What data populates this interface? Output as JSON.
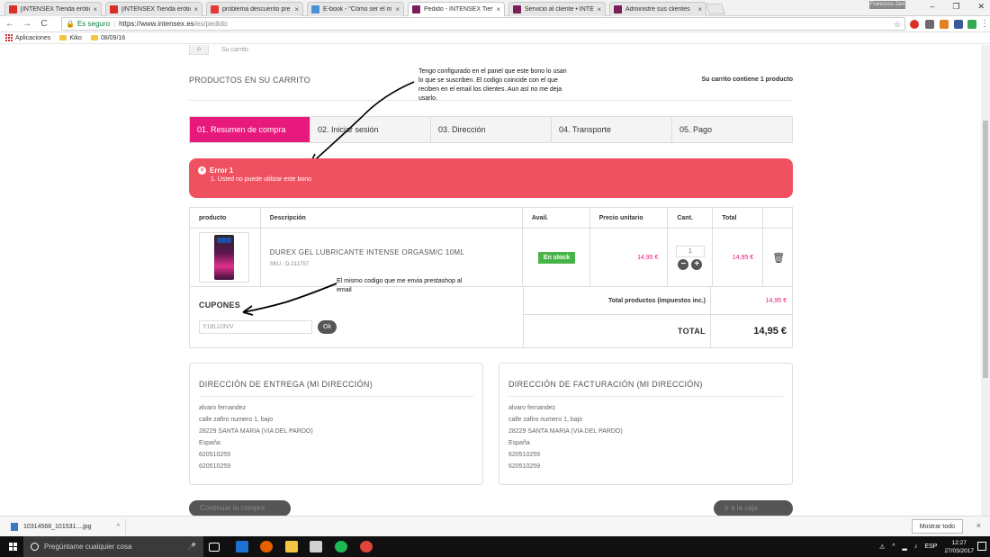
{
  "browser": {
    "tabs": [
      {
        "title": "[INTENSEX Tienda erótica",
        "color": "#d93025",
        "active": false
      },
      {
        "title": "[INTENSEX Tienda erótica",
        "color": "#d93025",
        "active": false
      },
      {
        "title": "problema descuento pre",
        "color": "#e53935",
        "active": false
      },
      {
        "title": "E-book - \"Cómo ser el m",
        "color": "#4a90d9",
        "active": false
      },
      {
        "title": "Pedido - INTENSEX Tien",
        "color": "#7a1f5a",
        "active": true
      },
      {
        "title": "Servicio al cliente • INTE",
        "color": "#7a1f5a",
        "active": false
      },
      {
        "title": "Administre sus clientes",
        "color": "#7a1f5a",
        "active": false
      }
    ],
    "tab_close": "×",
    "user_name": "Francisco Javi",
    "win_min": "–",
    "win_max": "❐",
    "win_close": "✕",
    "back": "←",
    "forward": "→",
    "reload": "C",
    "home": "⌂",
    "secure_label": "Es seguro",
    "url_domain": "https://www.intensex.es",
    "url_path": "/es/pedido",
    "star": "☆",
    "menu": "⋮",
    "bookmarks": [
      {
        "label": "Aplicaciones",
        "type": "apps"
      },
      {
        "label": "Kiko",
        "type": "folder"
      },
      {
        "label": "08/09/16",
        "type": "folder"
      }
    ]
  },
  "page": {
    "breadcrumb_home": "⌂",
    "breadcrumb_current": "Su carrito",
    "title": "PRODUCTOS EN SU CARRITO",
    "cart_count": "Su carrito contiene 1 producto",
    "annotation_top": [
      "Tengo configurado en el panel que este bono lo usan",
      "lo que se suscriben. El codigo coincide con el que",
      "reciben en el email los clientes. Aun así no me deja",
      "usarlo."
    ],
    "annotation_coupon": [
      "El mismo codigo que me envia prestashop al",
      "email"
    ],
    "steps": [
      {
        "label": "01. Resumen de compra",
        "active": true
      },
      {
        "label": "02. Iniciar sesión",
        "active": false
      },
      {
        "label": "03. Dirección",
        "active": false
      },
      {
        "label": "04. Transporte",
        "active": false
      },
      {
        "label": "05. Pago",
        "active": false
      }
    ],
    "error": {
      "icon": "×",
      "title": "Error 1",
      "message": "1. Usted no puede utilizar este bono"
    },
    "table_headers": [
      "producto",
      "Descripción",
      "Avail.",
      "Precio unitario",
      "Cant.",
      "Total",
      ""
    ],
    "product": {
      "name": "DUREX GEL LUBRICANTE INTENSE ORGASMIC 10ML",
      "sku": "SKU : D-211757",
      "availability": "En stock",
      "unit_price": "14,95 €",
      "quantity": "1",
      "minus": "−",
      "plus": "+",
      "total": "14,95 €",
      "delete": "🗑"
    },
    "coupons": {
      "title": "CUPONES",
      "code": "Y18LU3VV",
      "ok": "Ok"
    },
    "totals": {
      "products_label": "Total productos (impuestos inc.)",
      "products_value": "14,95 €",
      "grand_label": "TOTAL",
      "grand_value": "14,95 €"
    },
    "delivery": {
      "title": "DIRECCIÓN DE ENTREGA (MI DIRECCIÓN)",
      "lines": [
        "alvaro fernandez",
        "calle zafiro numero 1, bajo",
        "28229 SANTA MARIA (VIA DEL PARDO)",
        "España",
        "620510259",
        "620510259"
      ]
    },
    "billing": {
      "title": "DIRECCIÓN DE FACTURACIÓN (MI DIRECCIÓN)",
      "lines": [
        "alvaro fernandez",
        "calle zafiro numero 1, bajo",
        "28229 SANTA MARIA (VIA DEL PARDO)",
        "España",
        "620510259",
        "620510259"
      ]
    },
    "continue_button": "Continuar la compra",
    "checkout_button": "Ir a la caja"
  },
  "downloads": {
    "file": "10314568_101531....jpg",
    "caret": "^",
    "show_all": "Mostrar todo",
    "close": "×"
  },
  "taskbar": {
    "search_placeholder": "Pregúntame cualquier cosa",
    "lang": "ESP",
    "time": "12:27",
    "date": "27/03/2017"
  }
}
